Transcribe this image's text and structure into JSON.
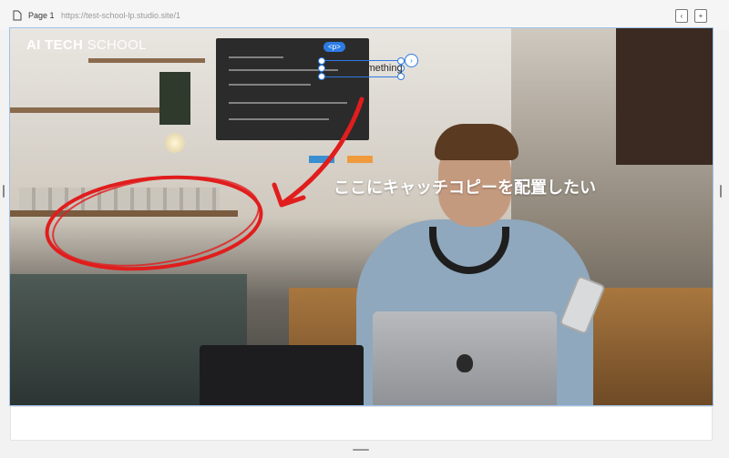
{
  "toolbar": {
    "page_label": "Page 1",
    "url": "https://test-school-lp.studio.site/1",
    "btn_left_icon": "page-back-icon",
    "btn_right_icon": "add-page-icon"
  },
  "hero": {
    "logo_bold": "AI TECH",
    "logo_light": "SCHOOL",
    "catch_copy": "ここにキャッチコピーを配置したい"
  },
  "selection": {
    "tag": "<p>",
    "text": "Something"
  },
  "colors": {
    "accent": "#2c7be5",
    "annotation": "#e11d1d",
    "canvas_outline": "#9ec3ea"
  }
}
